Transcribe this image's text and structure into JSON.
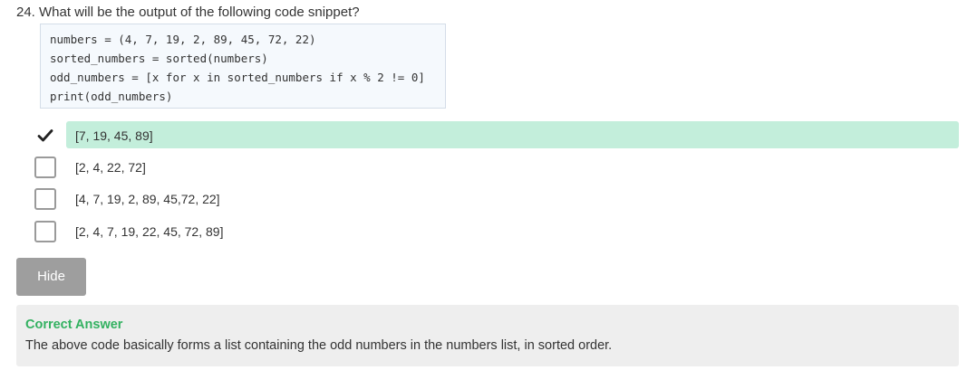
{
  "question": {
    "text": "24. What will be the output of the following code snippet?"
  },
  "code": {
    "lines": [
      "numbers = (4, 7, 19, 2, 89, 45, 72, 22)",
      "sorted_numbers = sorted(numbers)",
      "odd_numbers = [x for x in sorted_numbers if x % 2 != 0]",
      "print(odd_numbers)"
    ]
  },
  "options": [
    {
      "label": "[7, 19, 45, 89]",
      "checked": true,
      "correct": true
    },
    {
      "label": "[2, 4, 22, 72]",
      "checked": false,
      "correct": false
    },
    {
      "label": "[4, 7, 19, 2, 89, 45,72, 22]",
      "checked": false,
      "correct": false
    },
    {
      "label": "[2, 4, 7, 19, 22, 45, 72, 89]",
      "checked": false,
      "correct": false
    }
  ],
  "hide_button": {
    "label": "Hide"
  },
  "answer": {
    "title": "Correct Answer",
    "explanation": "The above code basically forms a list containing the odd numbers in the numbers list, in sorted order."
  },
  "colors": {
    "correct_highlight": "#c3eedb",
    "correct_title": "#32b160",
    "button_bg": "#9e9e9e",
    "answer_bg": "#eeeeee"
  },
  "icons": {
    "checked": "checkmark-icon",
    "unchecked": "empty-checkbox-icon"
  }
}
